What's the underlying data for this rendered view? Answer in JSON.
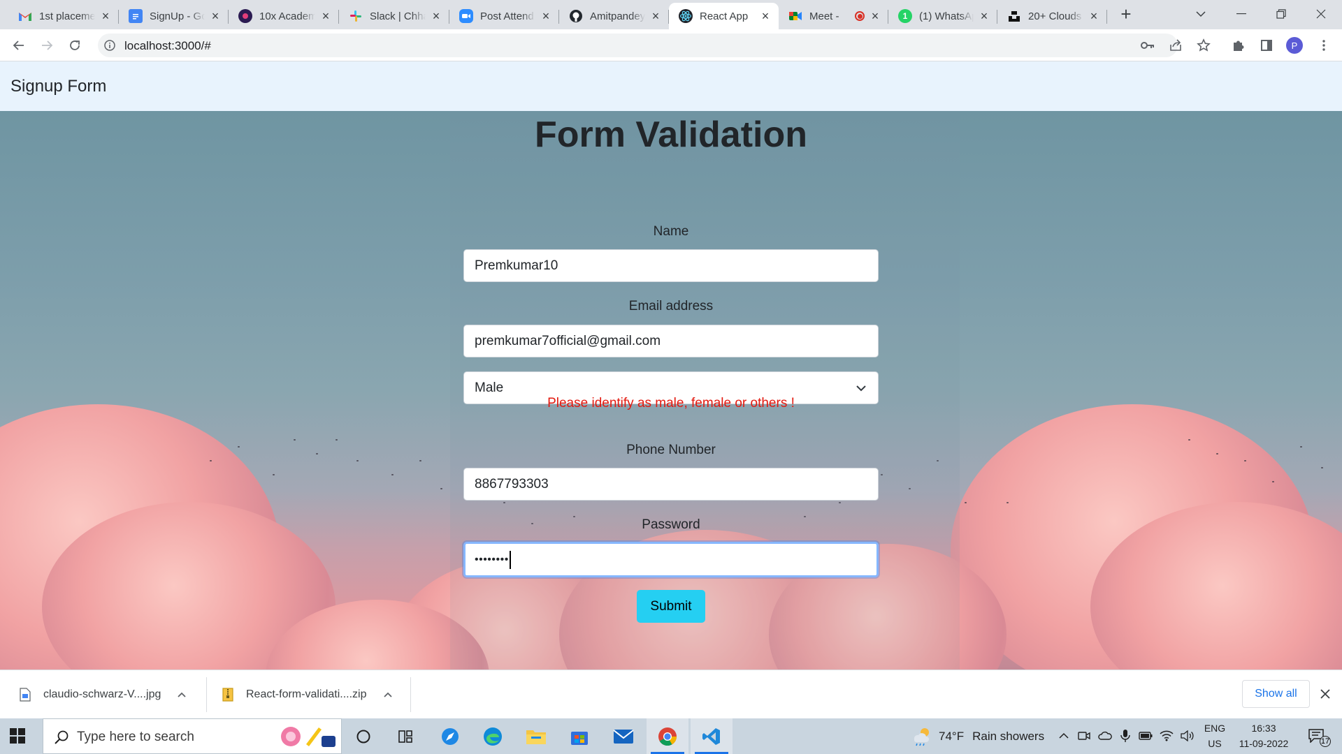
{
  "browser": {
    "tabs": [
      {
        "title": "1st placeme",
        "icon": "gmail-icon",
        "color": "#ea4335"
      },
      {
        "title": "SignUp - Go",
        "icon": "google-docs-icon",
        "color": "#4285f4"
      },
      {
        "title": "10x Academ",
        "icon": "10x-academy-icon",
        "color": "#2b1b52"
      },
      {
        "title": "Slack | Chha",
        "icon": "slack-icon",
        "color": "#e01e5a"
      },
      {
        "title": "Post Attend",
        "icon": "zoom-icon",
        "color": "#2d8cff"
      },
      {
        "title": "Amitpandey",
        "icon": "github-icon",
        "color": "#24292f"
      },
      {
        "title": "React App",
        "icon": "react-icon",
        "color": "#61dafb"
      },
      {
        "title": "Meet - ",
        "icon": "google-meet-icon",
        "color": "#00832d"
      },
      {
        "title": "(1) WhatsAp",
        "icon": "whatsapp-icon",
        "color": "#25d366"
      },
      {
        "title": "20+ Clouds",
        "icon": "unsplash-icon",
        "color": "#111111"
      }
    ],
    "active_tab_index": 6,
    "url": "localhost:3000/#",
    "profile_initial": "P"
  },
  "page": {
    "brand": "Signup Form",
    "form": {
      "title": "Form Validation",
      "name_label": "Name",
      "name_value": "Premkumar10",
      "email_label": "Email address",
      "email_value": "premkumar7official@gmail.com",
      "gender_value": "Male",
      "gender_error": "Please identify as male, female or others !",
      "phone_label": "Phone Number",
      "phone_value": "8867793303",
      "password_label": "Password",
      "password_mask": "••••••••",
      "submit_label": "Submit"
    },
    "colors": {
      "navbar_bg": "#e8f3fd",
      "error": "#e3190f",
      "submit_bg": "#25cff2",
      "focus_ring": "#86b7fe"
    }
  },
  "downloads": {
    "items": [
      {
        "name": "claudio-schwarz-V....jpg",
        "icon": "image-file-icon"
      },
      {
        "name": "React-form-validati....zip",
        "icon": "zip-file-icon"
      }
    ],
    "show_all_label": "Show all"
  },
  "taskbar": {
    "search_placeholder": "Type here to search",
    "apps": [
      "cortana-icon",
      "task-view-icon",
      "safari-icon",
      "edge-icon",
      "file-explorer-icon",
      "microsoft-store-icon",
      "mail-icon",
      "chrome-icon",
      "vscode-icon"
    ],
    "weather_temp": "74°F",
    "weather_text": "Rain showers",
    "language": "ENG",
    "region": "US",
    "time": "16:33",
    "date": "11-09-2022",
    "notification_count": "17"
  }
}
